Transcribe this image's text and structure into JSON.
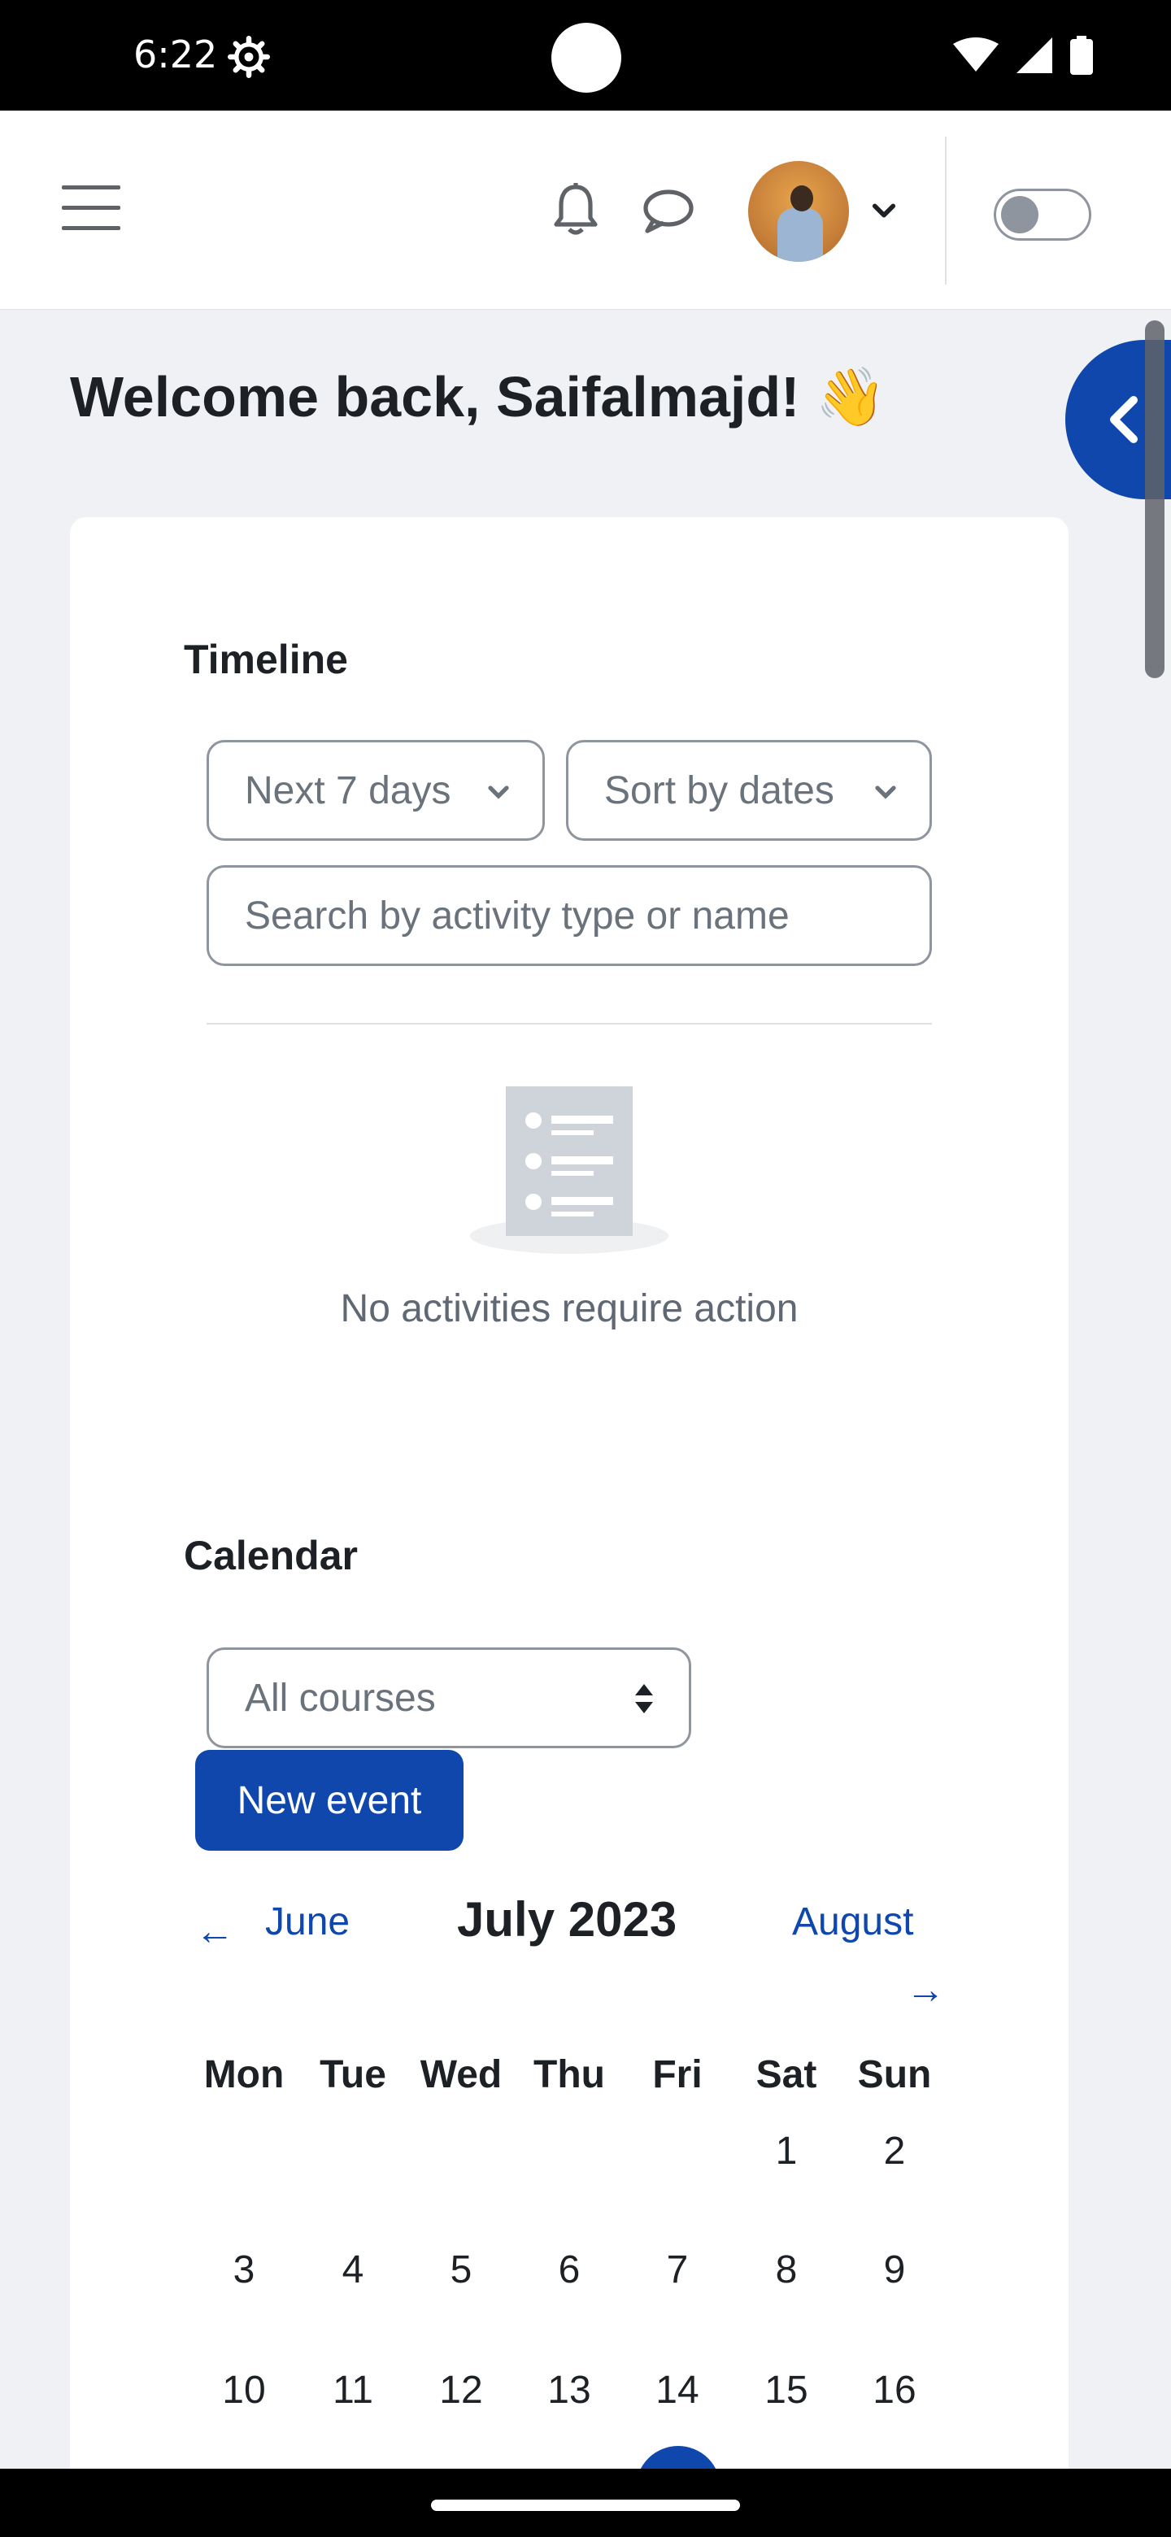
{
  "status_bar": {
    "time": "6:22"
  },
  "header": {
    "menu_icon": "hamburger-icon",
    "notifications_icon": "bell-icon",
    "messages_icon": "chat-bubble-icon",
    "user_menu_icon": "chevron-down-icon",
    "edit_mode_toggle": "off"
  },
  "welcome": {
    "text": "Welcome back, Saifalmajd! 👋"
  },
  "timeline": {
    "title": "Timeline",
    "filter_days": "Next 7 days",
    "sort": "Sort by dates",
    "search_placeholder": "Search by activity type or name",
    "empty_message": "No activities require action"
  },
  "calendar": {
    "title": "Calendar",
    "course_filter": "All courses",
    "new_event_label": "New event",
    "prev_month": "June",
    "prev_arrow": "←",
    "current_month": "July 2023",
    "next_month": "August",
    "next_arrow": "→",
    "weekdays": [
      "Mon",
      "Tue",
      "Wed",
      "Thu",
      "Fri",
      "Sat",
      "Sun"
    ],
    "weeks": [
      [
        "",
        "",
        "",
        "",
        "",
        "1",
        "2"
      ],
      [
        "3",
        "4",
        "5",
        "6",
        "7",
        "8",
        "9"
      ],
      [
        "10",
        "11",
        "12",
        "13",
        "14",
        "15",
        "16"
      ]
    ]
  },
  "colors": {
    "primary": "#0f47ad",
    "text": "#1d2125",
    "muted": "#6a737b",
    "page_bg": "#f0f1f4"
  }
}
